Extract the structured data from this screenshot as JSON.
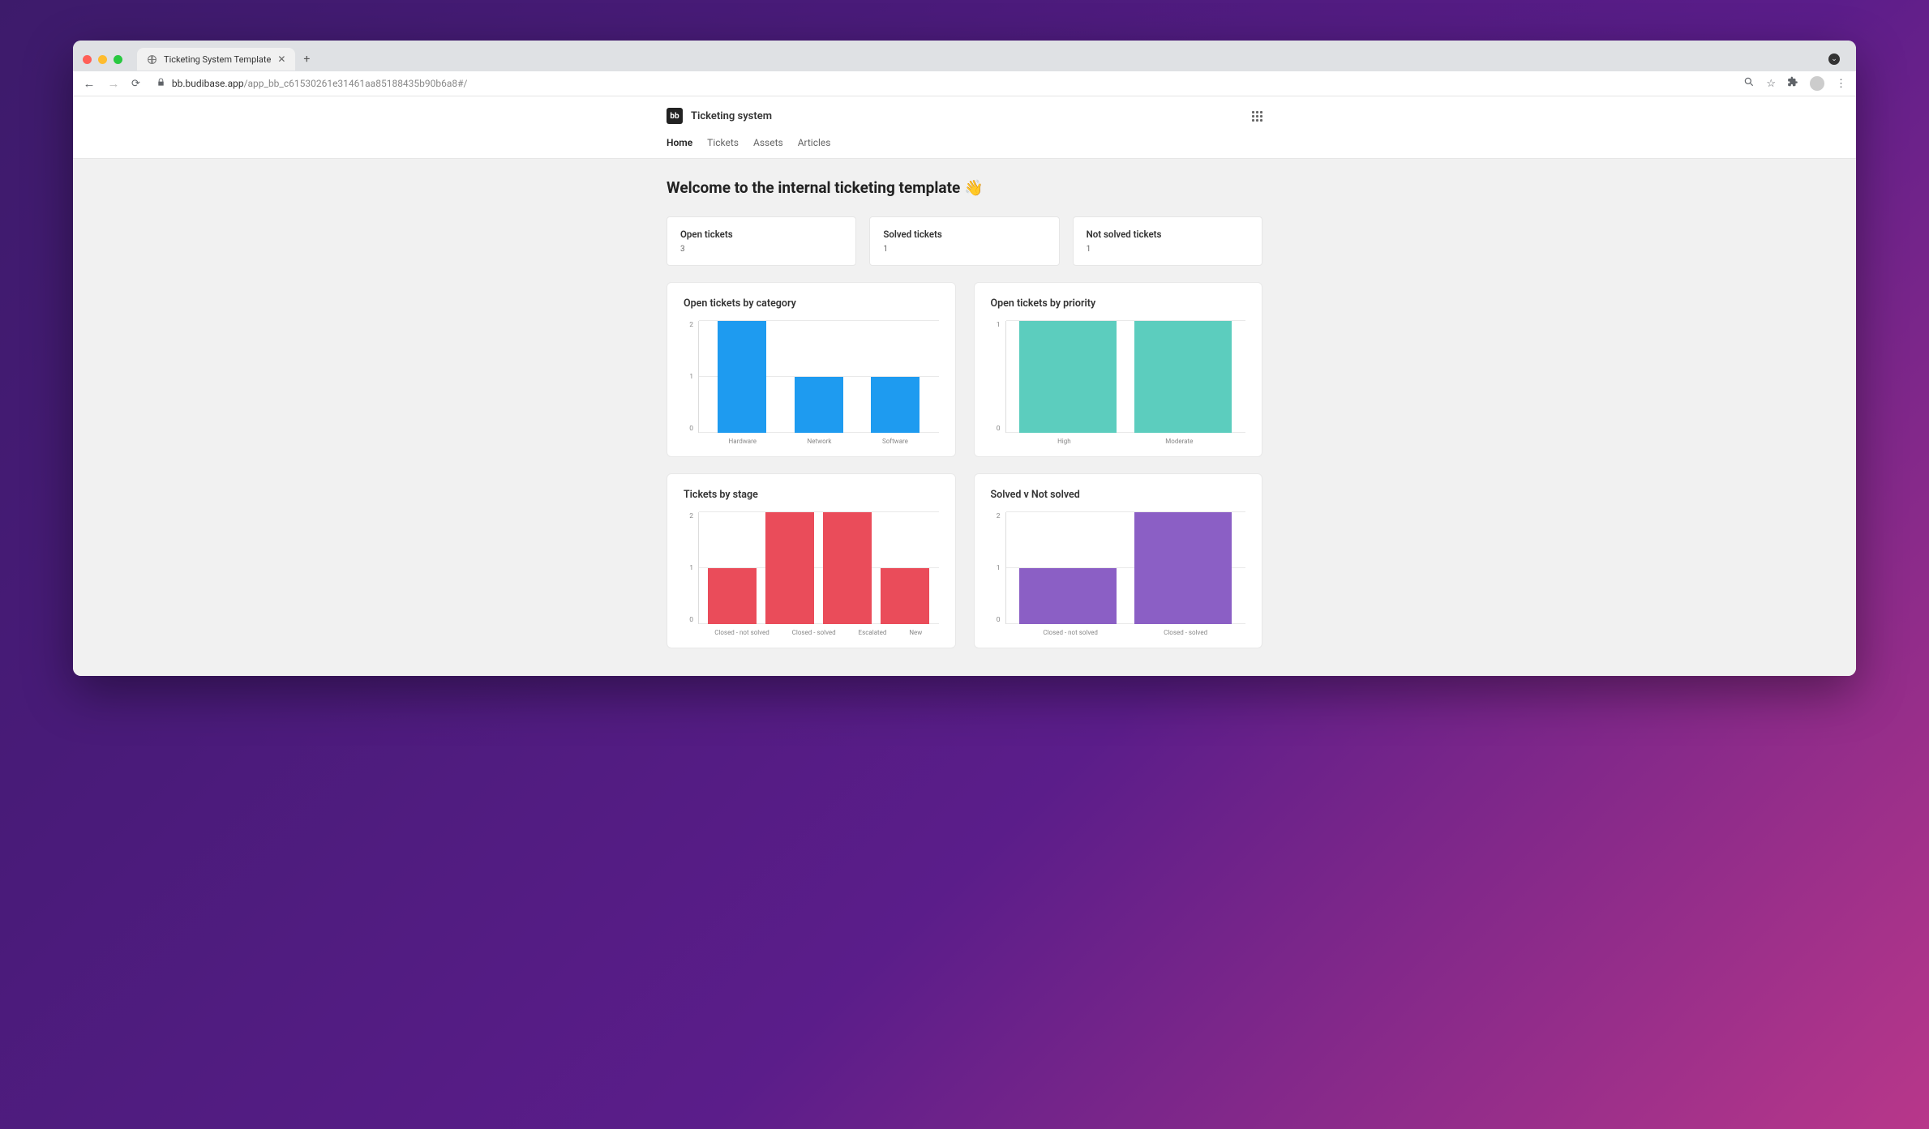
{
  "browser": {
    "tab_title": "Ticketing System Template",
    "url_host": "bb.budibase.app",
    "url_path": "/app_bb_c61530261e31461aa85188435b90b6a8#/"
  },
  "app": {
    "brand_badge": "bb",
    "brand_name": "Ticketing system",
    "nav": [
      {
        "label": "Home",
        "active": true
      },
      {
        "label": "Tickets",
        "active": false
      },
      {
        "label": "Assets",
        "active": false
      },
      {
        "label": "Articles",
        "active": false
      }
    ]
  },
  "page": {
    "title": "Welcome to the internal ticketing template 👋"
  },
  "stats": [
    {
      "label": "Open tickets",
      "value": "3"
    },
    {
      "label": "Solved tickets",
      "value": "1"
    },
    {
      "label": "Not solved tickets",
      "value": "1"
    }
  ],
  "chart_data": [
    {
      "id": "by_category",
      "type": "bar",
      "title": "Open tickets by category",
      "categories": [
        "Hardware",
        "Network",
        "Software"
      ],
      "values": [
        2,
        1,
        1
      ],
      "ylim": [
        0,
        2
      ],
      "yticks": [
        0,
        1,
        2
      ],
      "color": "#1e9bf0"
    },
    {
      "id": "by_priority",
      "type": "bar",
      "title": "Open tickets by priority",
      "categories": [
        "High",
        "Moderate"
      ],
      "values": [
        1,
        1
      ],
      "ylim": [
        0,
        1
      ],
      "yticks": [
        0,
        1
      ],
      "color": "#5ccdbe"
    },
    {
      "id": "by_stage",
      "type": "bar",
      "title": "Tickets by stage",
      "categories": [
        "Closed - not solved",
        "Closed - solved",
        "Escalated",
        "New"
      ],
      "values": [
        1,
        2,
        2,
        1
      ],
      "ylim": [
        0,
        2
      ],
      "yticks": [
        0,
        1,
        2
      ],
      "color": "#ea4c5a"
    },
    {
      "id": "solved_vs_not",
      "type": "bar",
      "title": "Solved v Not solved",
      "categories": [
        "Closed - not solved",
        "Closed - solved"
      ],
      "values": [
        1,
        2
      ],
      "ylim": [
        0,
        2
      ],
      "yticks": [
        0,
        1,
        2
      ],
      "color": "#8b5fc5"
    }
  ]
}
